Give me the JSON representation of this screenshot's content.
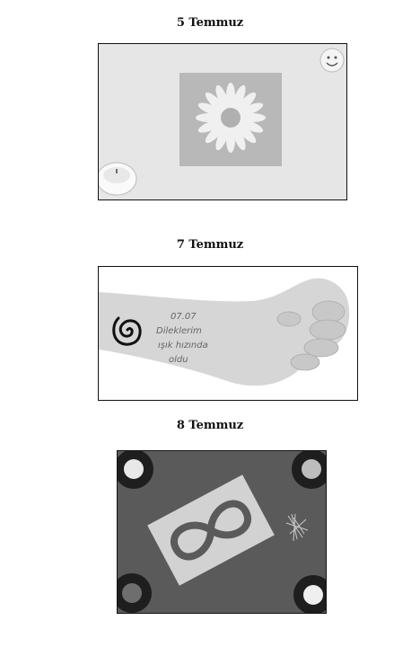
{
  "entries": [
    {
      "date": "5 Temmuz"
    },
    {
      "date": "7 Temmuz",
      "arm_text": [
        "07.07",
        "Dileklerim",
        "ışık hızında",
        "oldu"
      ]
    },
    {
      "date": "8 Temmuz"
    }
  ],
  "colors": {
    "photo_border": "#111111",
    "table_dark": "#5a5a5a",
    "paper": "#d2d2d2"
  },
  "icons": [
    "daisy-icon",
    "smiley-icon",
    "candle-icon",
    "spiral-icon",
    "infinity-icon"
  ]
}
